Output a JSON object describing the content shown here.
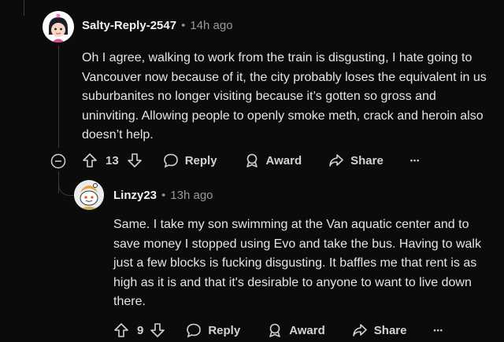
{
  "comment1": {
    "username": "Salty-Reply-2547",
    "age": "14h ago",
    "text": "Oh I agree, walking to work from the train is disgusting, I hate going to Vancouver now because of it, the city probably loses the equivalent in us suburbanites no longer visiting because it’s gotten so gross and uninviting. Allowing people to openly smoke meth, crack and heroin also doesn’t help.",
    "votes": "13",
    "reply_label": "Reply",
    "award_label": "Award",
    "share_label": "Share",
    "more_label": "•••"
  },
  "comment2": {
    "username": "Linzy23",
    "age": "13h ago",
    "text": "Same. I take my son swimming at the Van aquatic center and to save money I stopped using Evo and take the bus. Having to walk just a few blocks is fucking disgusting. It baffles me that rent is as high as it is and that it's desirable to anyone to want to live down there.",
    "votes": "9",
    "reply_label": "Reply",
    "award_label": "Award",
    "share_label": "Share",
    "more_label": "•••"
  },
  "separator": "•",
  "icons": [
    "collapse-icon",
    "upvote-icon",
    "downvote-icon",
    "reply-icon",
    "award-icon",
    "share-icon",
    "more-icon"
  ]
}
